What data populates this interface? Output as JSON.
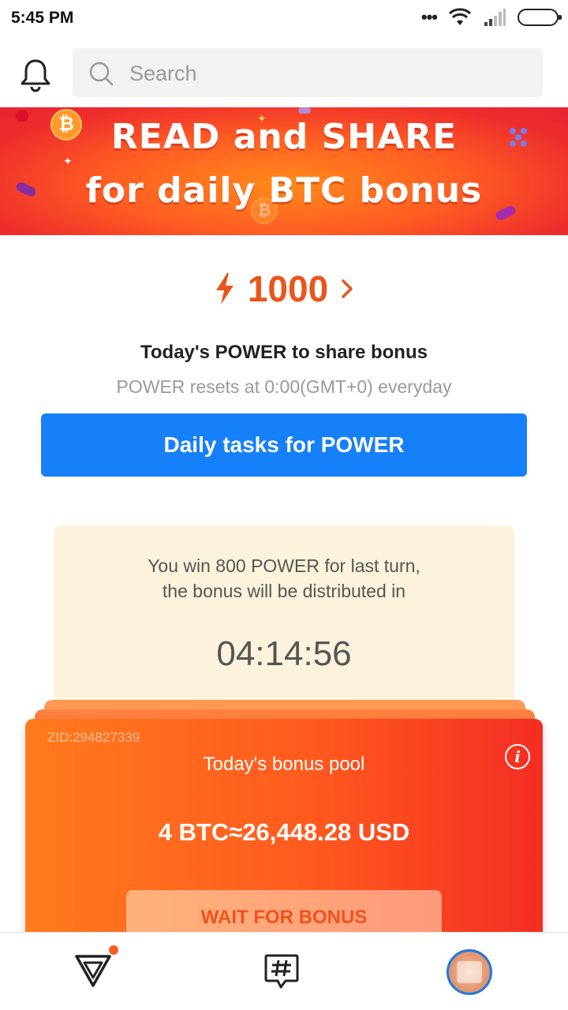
{
  "status_bar": {
    "time": "5:45 PM",
    "icons": [
      "more-dots-icon",
      "wifi-icon",
      "signal-icon",
      "battery-icon"
    ]
  },
  "header": {
    "search_placeholder": "Search",
    "icons": [
      "bell-icon",
      "search-icon"
    ]
  },
  "banner": {
    "line1": "READ and SHARE",
    "line2": "for daily BTC bonus"
  },
  "power": {
    "value": "1000",
    "title": "Today's POWER to share bonus",
    "subtitle": "POWER resets at 0:00(GMT+0) everyday",
    "tasks_button": "Daily tasks for POWER",
    "accent_color": "#e8561c",
    "button_color": "#1680fa"
  },
  "info_card": {
    "line1": "You win 800 POWER for last turn,",
    "line2": "the bonus will be distributed in",
    "countdown": "04:14:56"
  },
  "bonus_card": {
    "zid": "ZID:294827339",
    "title": "Today's bonus pool",
    "amount": "4 BTC≈26,448.28 USD",
    "wait_button": "WAIT FOR BONUS"
  },
  "bottom_nav": {
    "items": [
      {
        "icon": "home-triangle-icon",
        "has_notification": true
      },
      {
        "icon": "hashtag-chat-icon"
      },
      {
        "icon": "avatar"
      }
    ]
  }
}
